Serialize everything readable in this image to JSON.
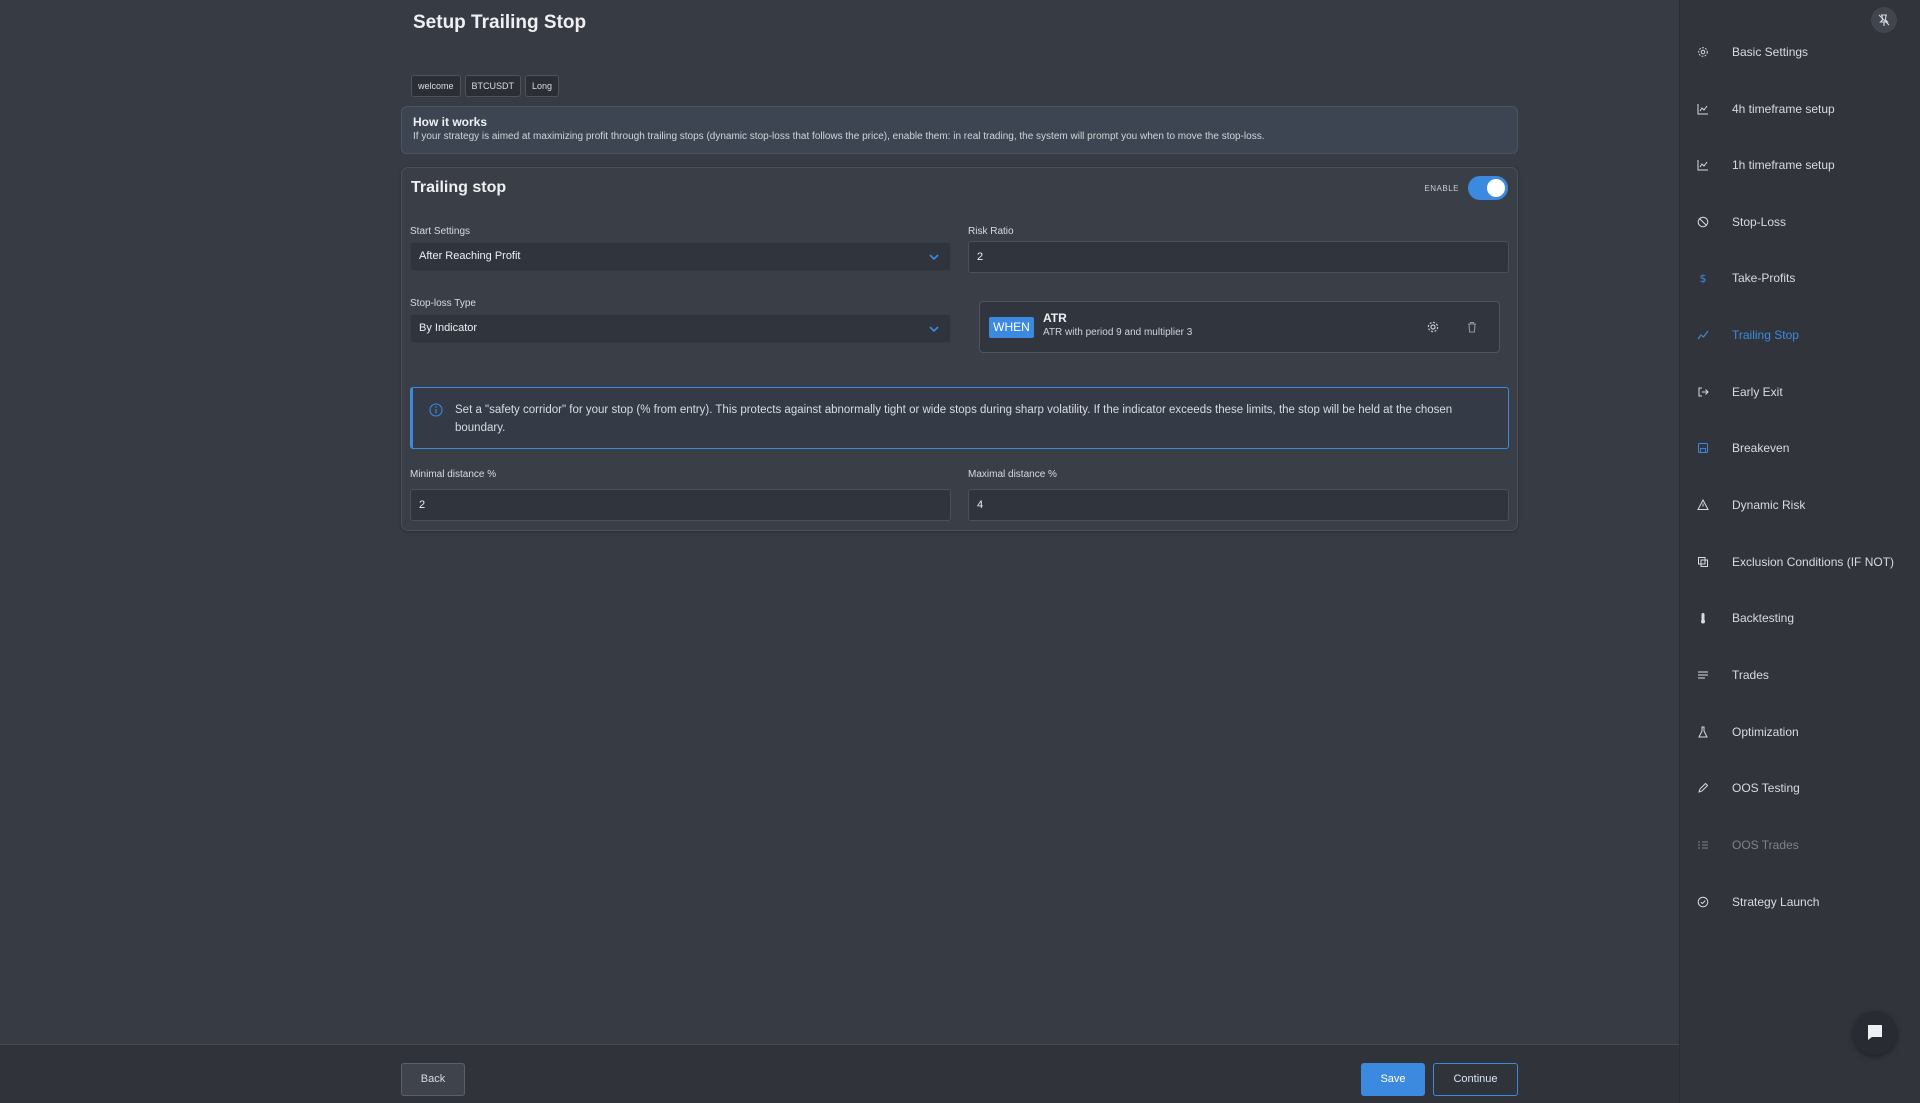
{
  "page": {
    "title": "Setup Trailing Stop",
    "tags": [
      "welcome",
      "BTCUSDT",
      "Long"
    ]
  },
  "how_it_works": {
    "title": "How it works",
    "description": "If your strategy is aimed at maximizing profit through trailing stops (dynamic stop-loss that follows the price), enable them: in real trading, the system will prompt you when to move the stop-loss."
  },
  "trailing_stop": {
    "title": "Trailing stop",
    "enable_label": "ENABLE",
    "enabled": true,
    "start_settings": {
      "label": "Start Settings",
      "value": "After Reaching Profit"
    },
    "risk_ratio": {
      "label": "Risk Ratio",
      "value": "2"
    },
    "stop_loss_type": {
      "label": "Stop-loss Type",
      "value": "By Indicator"
    },
    "indicator": {
      "badge": "WHEN",
      "name": "ATR",
      "description": "ATR with period 9 and multiplier 3",
      "settings_icon": "gear-icon",
      "delete_icon": "trash-icon"
    },
    "notice": "Set a \"safety corridor\" for your stop (% from entry). This protects against abnormally tight or wide stops during sharp volatility. If the indicator exceeds these limits, the stop will be held at the chosen boundary.",
    "min_distance": {
      "label": "Minimal distance %",
      "value": "2"
    },
    "max_distance": {
      "label": "Maximal distance %",
      "value": "4"
    }
  },
  "footer": {
    "back": "Back",
    "save": "Save",
    "continue": "Continue"
  },
  "sidebar": {
    "items": [
      {
        "label": "Basic Settings",
        "icon": "gear-icon"
      },
      {
        "label": "4h timeframe setup",
        "icon": "chart-icon"
      },
      {
        "label": "1h timeframe setup",
        "icon": "chart-icon"
      },
      {
        "label": "Stop-Loss",
        "icon": "ban-icon"
      },
      {
        "label": "Take-Profits",
        "icon": "dollar-icon"
      },
      {
        "label": "Trailing Stop",
        "icon": "trend-icon"
      },
      {
        "label": "Early Exit",
        "icon": "exit-icon"
      },
      {
        "label": "Breakeven",
        "icon": "save-icon"
      },
      {
        "label": "Dynamic Risk",
        "icon": "warning-icon"
      },
      {
        "label": "Exclusion Conditions (IF NOT)",
        "icon": "copy-icon"
      },
      {
        "label": "Backtesting",
        "icon": "thermometer-icon"
      },
      {
        "label": "Trades",
        "icon": "list-icon"
      },
      {
        "label": "Optimization",
        "icon": "flask-icon"
      },
      {
        "label": "OOS Testing",
        "icon": "pen-icon"
      },
      {
        "label": "OOS Trades",
        "icon": "list-check-icon"
      },
      {
        "label": "Strategy Launch",
        "icon": "check-circle-icon"
      }
    ],
    "active": "Trailing Stop",
    "disabled": "OOS Trades"
  },
  "colors": {
    "accent": "#3c8ae0",
    "background": "#373b44",
    "sidebar": "#31343b"
  }
}
